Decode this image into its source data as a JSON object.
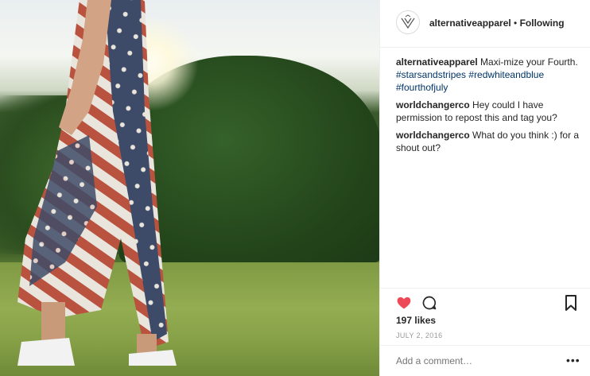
{
  "post": {
    "image_alt": "",
    "header": {
      "username": "alternativeapparel",
      "separator": " • ",
      "follow_status": "Following"
    },
    "caption": {
      "username": "alternativeapparel",
      "text": " Maxi-mize your Fourth. ",
      "hashtags": [
        "#starsandstripes",
        "#redwhiteandblue",
        "#fourthofjuly"
      ]
    },
    "comments": [
      {
        "username": "worldchangerco",
        "text": " Hey could I have permission to repost this and tag you?"
      },
      {
        "username": "worldchangerco",
        "text": " What do you think :) for a shout out?"
      }
    ],
    "likes": "197 likes",
    "date": "JULY 2, 2016",
    "add_comment_placeholder": "Add a comment…",
    "more_label": "•••",
    "liked": true,
    "colors": {
      "heart": "#ed4956",
      "hashtag": "#003569",
      "text": "#262626",
      "muted": "#999999"
    },
    "icons": {
      "heart": "heart-icon",
      "comment": "comment-icon",
      "bookmark": "bookmark-icon",
      "avatar": "brand-logo-icon"
    }
  }
}
